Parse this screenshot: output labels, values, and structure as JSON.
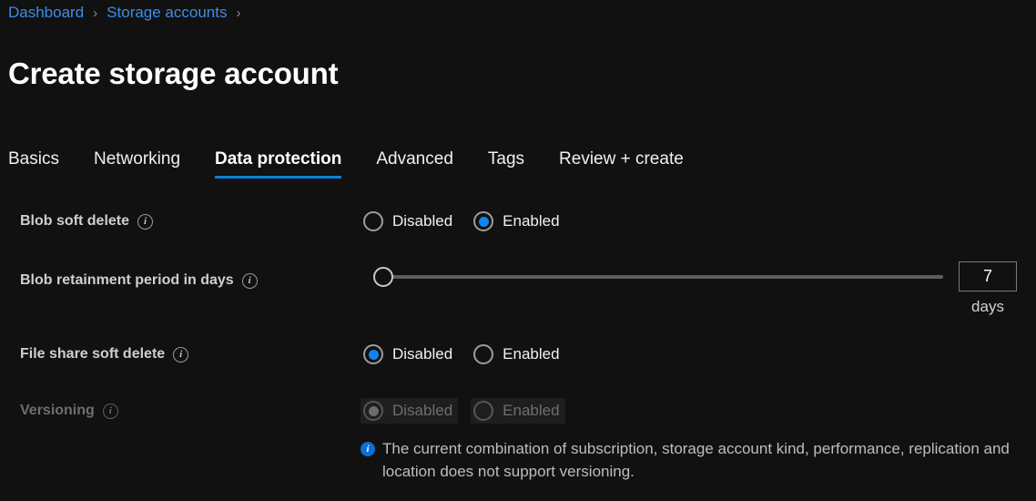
{
  "breadcrumb": {
    "items": [
      {
        "label": "Dashboard"
      },
      {
        "label": "Storage accounts"
      }
    ],
    "separator": "›"
  },
  "page_title": "Create storage account",
  "tabs": [
    {
      "label": "Basics",
      "active": false
    },
    {
      "label": "Networking",
      "active": false
    },
    {
      "label": "Data protection",
      "active": true
    },
    {
      "label": "Advanced",
      "active": false
    },
    {
      "label": "Tags",
      "active": false
    },
    {
      "label": "Review + create",
      "active": false
    }
  ],
  "form": {
    "blob_soft_delete": {
      "label": "Blob soft delete",
      "info_glyph": "i",
      "options": [
        {
          "label": "Disabled",
          "selected": false
        },
        {
          "label": "Enabled",
          "selected": true
        }
      ]
    },
    "blob_retainment": {
      "label": "Blob retainment period in days",
      "info_glyph": "i",
      "value": "7",
      "unit": "days",
      "slider_position_percent": 0
    },
    "file_share_soft_delete": {
      "label": "File share soft delete",
      "info_glyph": "i",
      "options": [
        {
          "label": "Disabled",
          "selected": true
        },
        {
          "label": "Enabled",
          "selected": false
        }
      ]
    },
    "versioning": {
      "label": "Versioning",
      "info_glyph": "i",
      "disabled": true,
      "options": [
        {
          "label": "Disabled",
          "selected": true
        },
        {
          "label": "Enabled",
          "selected": false
        }
      ],
      "message": {
        "badge_glyph": "i",
        "text": "The current combination of subscription, storage account kind, performance, replication and location does not support versioning."
      }
    }
  },
  "colors": {
    "background": "#111111",
    "accent_blue": "#0e85f2",
    "link_blue": "#3b8eea",
    "tab_underline": "#0f7fd4",
    "info_badge": "#0e6fd4"
  }
}
